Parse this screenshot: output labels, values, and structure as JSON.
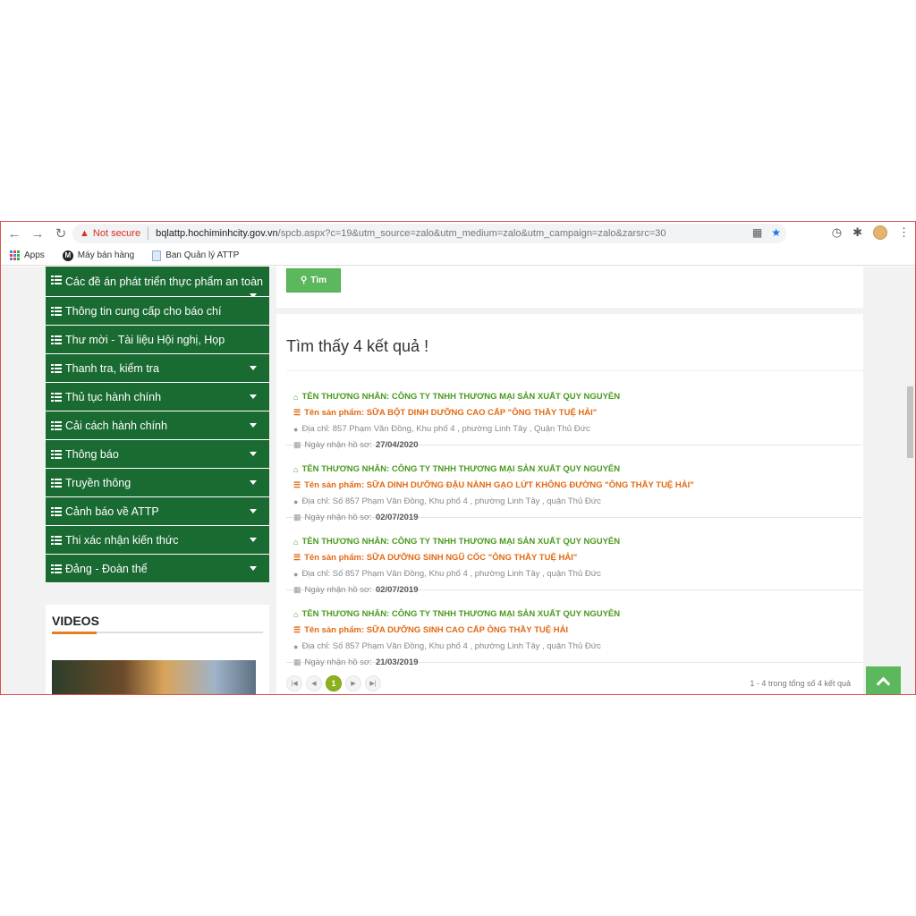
{
  "browser": {
    "security_label": "Not secure",
    "url_host": "bqlattp.hochiminhcity.gov.vn",
    "url_rest": "/spcb.aspx?c=19&utm_source=zalo&utm_medium=zalo&utm_campaign=zalo&zarsrc=30",
    "bookmarks": [
      "Apps",
      "Máy bán hàng",
      "Ban Quản lý ATTP"
    ]
  },
  "sidebar": {
    "items": [
      "Các đề án phát triển thực phẩm an toàn",
      "Thông tin cung cấp cho báo chí",
      "Thư mời - Tài liệu Hội nghị, Họp",
      "Thanh tra, kiểm tra",
      "Thủ tục hành chính",
      "Cải cách hành chính",
      "Thông báo",
      "Truyền thông",
      "Cảnh báo về ATTP",
      "Thi xác nhận kiến thức",
      "Đảng - Đoàn thể"
    ],
    "videos_title": "VIDEOS"
  },
  "search": {
    "button_label": "Tìm"
  },
  "results": {
    "heading": "Tìm thấy 4 kết quả !",
    "items": [
      {
        "merchant": "TÊN THƯƠNG NHÂN: CÔNG TY TNHH THƯƠNG MẠI SẢN XUẤT QUY NGUYÊN",
        "product": "Tên sản phẩm: SỮA BỘT DINH DƯỠNG CAO CẤP \"ÔNG THẦY TUỆ HẢI\"",
        "address": "Địa chỉ: 857 Phạm Văn Đồng, Khu phố 4 , phường Linh Tây , Quận Thủ Đức",
        "date_label": "Ngày nhận hồ sơ:",
        "date": "27/04/2020"
      },
      {
        "merchant": "TÊN THƯƠNG NHÂN: CÔNG TY TNHH THƯƠNG MẠI SẢN XUẤT QUY NGUYÊN",
        "product": "Tên sản phẩm: SỮA DINH DƯỠNG ĐẬU NÀNH GẠO LỨT KHÔNG ĐƯỜNG \"ÔNG THẦY TUỆ HẢI\"",
        "address": "Địa chỉ: Số 857 Phạm Văn Đồng, Khu phố 4 , phường Linh Tây , quận Thủ Đức",
        "date_label": "Ngày nhận hồ sơ:",
        "date": "02/07/2019"
      },
      {
        "merchant": "TÊN THƯƠNG NHÂN: CÔNG TY TNHH THƯƠNG MẠI SẢN XUẤT QUY NGUYÊN",
        "product": "Tên sản phẩm: SỮA DƯỠNG SINH NGŨ CỐC \"ÔNG THẦY TUỆ HẢI\"",
        "address": "Địa chỉ: Số 857 Phạm Văn Đồng, Khu phố 4 , phường Linh Tây , quận Thủ Đức",
        "date_label": "Ngày nhận hồ sơ:",
        "date": "02/07/2019"
      },
      {
        "merchant": "TÊN THƯƠNG NHÂN: CÔNG TY TNHH THƯƠNG MẠI SẢN XUẤT QUY NGUYÊN",
        "product": "Tên sản phẩm: SỮA DƯỠNG SINH CAO CẤP ÔNG THẦY TUỆ HẢI",
        "address": "Địa chỉ: Số 857 Phạm Văn Đồng, Khu phố 4 , phường Linh Tây , quận Thủ Đức",
        "date_label": "Ngày nhận hồ sơ:",
        "date": "21/03/2019"
      }
    ],
    "pager": {
      "current": "1",
      "info": "1 - 4 trong tổng số 4 kết quả"
    }
  },
  "colors": {
    "menu_green": "#1a6b32",
    "button_green": "#5cb85c",
    "merchant_green": "#4a9a1c",
    "product_orange": "#e26a14"
  },
  "icons": [
    "back-icon",
    "forward-icon",
    "reload-icon",
    "warning-icon",
    "translate-icon",
    "star-icon",
    "extensions-icon",
    "menu-icon",
    "search-icon",
    "home-icon",
    "list-icon",
    "map-pin-icon",
    "calendar-icon",
    "chevron-up-icon"
  ]
}
